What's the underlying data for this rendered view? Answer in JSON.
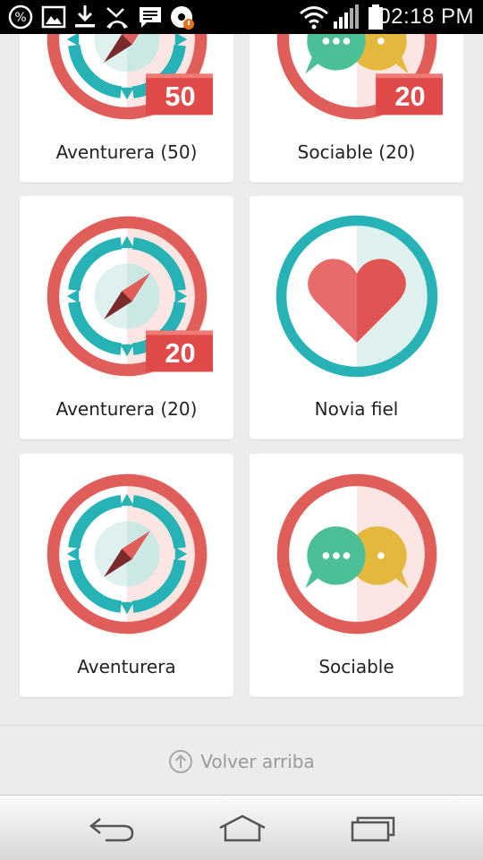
{
  "status_bar": {
    "time": "02:18 PM",
    "left_icons": [
      "percent-icon",
      "image-icon",
      "download-icon",
      "missed-call-icon",
      "message-icon",
      "app-notification-icon"
    ],
    "right_icons": [
      "wifi-icon",
      "signal-icon",
      "battery-icon"
    ]
  },
  "badges": [
    {
      "label": "Aventurera (50)",
      "type": "compass",
      "number": "50"
    },
    {
      "label": "Sociable (20)",
      "type": "chat",
      "number": "20"
    },
    {
      "label": "Aventurera (20)",
      "type": "compass",
      "number": "20"
    },
    {
      "label": "Novia fiel",
      "type": "heart",
      "number": ""
    },
    {
      "label": "Aventurera",
      "type": "compass",
      "number": ""
    },
    {
      "label": "Sociable",
      "type": "chat",
      "number": ""
    }
  ],
  "footer": {
    "back_to_top": "Volver arriba"
  },
  "nav": {
    "icons": [
      "back-icon",
      "home-icon",
      "recent-apps-icon"
    ]
  },
  "colors": {
    "ring_red": "#e05e5a",
    "teal": "#27b3b5",
    "heart_red": "#e05554",
    "number_red": "#e04a48",
    "chat_green": "#4bbf96",
    "chat_yellow": "#e4b83c"
  }
}
